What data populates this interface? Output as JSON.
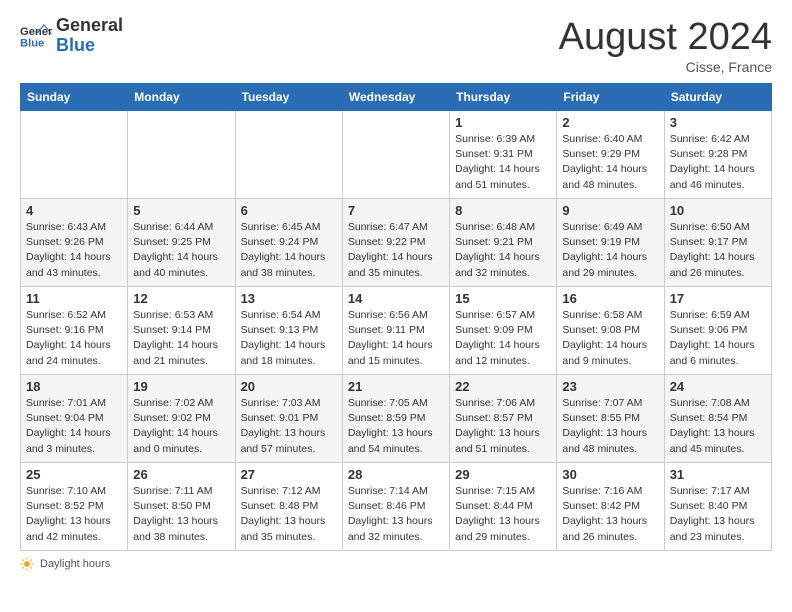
{
  "header": {
    "logo_general": "General",
    "logo_blue": "Blue",
    "month_title": "August 2024",
    "location": "Cisse, France"
  },
  "days_of_week": [
    "Sunday",
    "Monday",
    "Tuesday",
    "Wednesday",
    "Thursday",
    "Friday",
    "Saturday"
  ],
  "weeks": [
    [
      {
        "day": "",
        "info": ""
      },
      {
        "day": "",
        "info": ""
      },
      {
        "day": "",
        "info": ""
      },
      {
        "day": "",
        "info": ""
      },
      {
        "day": "1",
        "info": "Sunrise: 6:39 AM\nSunset: 9:31 PM\nDaylight: 14 hours and 51 minutes."
      },
      {
        "day": "2",
        "info": "Sunrise: 6:40 AM\nSunset: 9:29 PM\nDaylight: 14 hours and 48 minutes."
      },
      {
        "day": "3",
        "info": "Sunrise: 6:42 AM\nSunset: 9:28 PM\nDaylight: 14 hours and 46 minutes."
      }
    ],
    [
      {
        "day": "4",
        "info": "Sunrise: 6:43 AM\nSunset: 9:26 PM\nDaylight: 14 hours and 43 minutes."
      },
      {
        "day": "5",
        "info": "Sunrise: 6:44 AM\nSunset: 9:25 PM\nDaylight: 14 hours and 40 minutes."
      },
      {
        "day": "6",
        "info": "Sunrise: 6:45 AM\nSunset: 9:24 PM\nDaylight: 14 hours and 38 minutes."
      },
      {
        "day": "7",
        "info": "Sunrise: 6:47 AM\nSunset: 9:22 PM\nDaylight: 14 hours and 35 minutes."
      },
      {
        "day": "8",
        "info": "Sunrise: 6:48 AM\nSunset: 9:21 PM\nDaylight: 14 hours and 32 minutes."
      },
      {
        "day": "9",
        "info": "Sunrise: 6:49 AM\nSunset: 9:19 PM\nDaylight: 14 hours and 29 minutes."
      },
      {
        "day": "10",
        "info": "Sunrise: 6:50 AM\nSunset: 9:17 PM\nDaylight: 14 hours and 26 minutes."
      }
    ],
    [
      {
        "day": "11",
        "info": "Sunrise: 6:52 AM\nSunset: 9:16 PM\nDaylight: 14 hours and 24 minutes."
      },
      {
        "day": "12",
        "info": "Sunrise: 6:53 AM\nSunset: 9:14 PM\nDaylight: 14 hours and 21 minutes."
      },
      {
        "day": "13",
        "info": "Sunrise: 6:54 AM\nSunset: 9:13 PM\nDaylight: 14 hours and 18 minutes."
      },
      {
        "day": "14",
        "info": "Sunrise: 6:56 AM\nSunset: 9:11 PM\nDaylight: 14 hours and 15 minutes."
      },
      {
        "day": "15",
        "info": "Sunrise: 6:57 AM\nSunset: 9:09 PM\nDaylight: 14 hours and 12 minutes."
      },
      {
        "day": "16",
        "info": "Sunrise: 6:58 AM\nSunset: 9:08 PM\nDaylight: 14 hours and 9 minutes."
      },
      {
        "day": "17",
        "info": "Sunrise: 6:59 AM\nSunset: 9:06 PM\nDaylight: 14 hours and 6 minutes."
      }
    ],
    [
      {
        "day": "18",
        "info": "Sunrise: 7:01 AM\nSunset: 9:04 PM\nDaylight: 14 hours and 3 minutes."
      },
      {
        "day": "19",
        "info": "Sunrise: 7:02 AM\nSunset: 9:02 PM\nDaylight: 14 hours and 0 minutes."
      },
      {
        "day": "20",
        "info": "Sunrise: 7:03 AM\nSunset: 9:01 PM\nDaylight: 13 hours and 57 minutes."
      },
      {
        "day": "21",
        "info": "Sunrise: 7:05 AM\nSunset: 8:59 PM\nDaylight: 13 hours and 54 minutes."
      },
      {
        "day": "22",
        "info": "Sunrise: 7:06 AM\nSunset: 8:57 PM\nDaylight: 13 hours and 51 minutes."
      },
      {
        "day": "23",
        "info": "Sunrise: 7:07 AM\nSunset: 8:55 PM\nDaylight: 13 hours and 48 minutes."
      },
      {
        "day": "24",
        "info": "Sunrise: 7:08 AM\nSunset: 8:54 PM\nDaylight: 13 hours and 45 minutes."
      }
    ],
    [
      {
        "day": "25",
        "info": "Sunrise: 7:10 AM\nSunset: 8:52 PM\nDaylight: 13 hours and 42 minutes."
      },
      {
        "day": "26",
        "info": "Sunrise: 7:11 AM\nSunset: 8:50 PM\nDaylight: 13 hours and 38 minutes."
      },
      {
        "day": "27",
        "info": "Sunrise: 7:12 AM\nSunset: 8:48 PM\nDaylight: 13 hours and 35 minutes."
      },
      {
        "day": "28",
        "info": "Sunrise: 7:14 AM\nSunset: 8:46 PM\nDaylight: 13 hours and 32 minutes."
      },
      {
        "day": "29",
        "info": "Sunrise: 7:15 AM\nSunset: 8:44 PM\nDaylight: 13 hours and 29 minutes."
      },
      {
        "day": "30",
        "info": "Sunrise: 7:16 AM\nSunset: 8:42 PM\nDaylight: 13 hours and 26 minutes."
      },
      {
        "day": "31",
        "info": "Sunrise: 7:17 AM\nSunset: 8:40 PM\nDaylight: 13 hours and 23 minutes."
      }
    ]
  ],
  "footer": {
    "daylight_label": "Daylight hours"
  }
}
